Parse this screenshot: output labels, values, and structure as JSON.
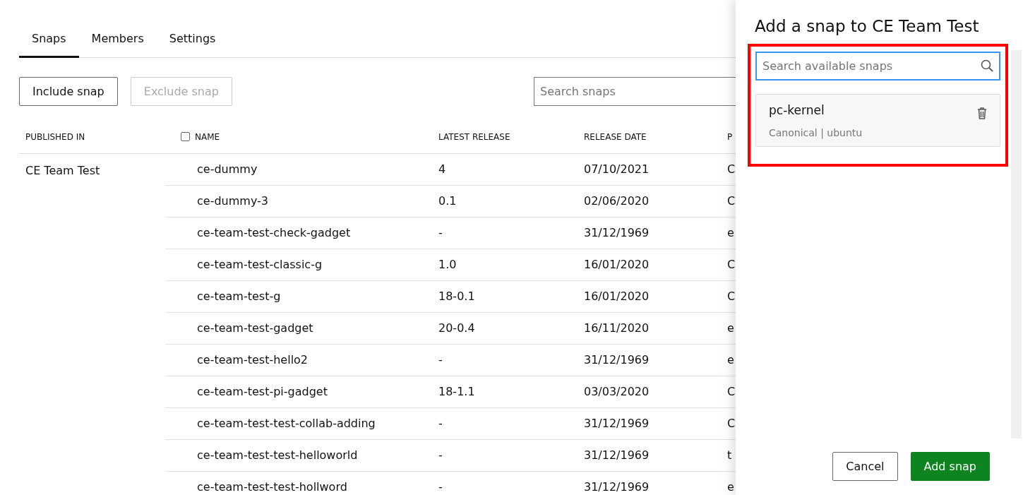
{
  "tabs": [
    {
      "label": "Snaps",
      "selected": true
    },
    {
      "label": "Members",
      "selected": false
    },
    {
      "label": "Settings",
      "selected": false
    }
  ],
  "toolbar": {
    "buttons": [
      {
        "label": "Include snap",
        "disabled": false
      },
      {
        "label": "Exclude snap",
        "disabled": true
      }
    ],
    "search": {
      "placeholder": "Search snaps"
    }
  },
  "table": {
    "columns": [
      "PUBLISHED IN",
      "NAME",
      "LATEST RELEASE",
      "RELEASE DATE",
      "P"
    ],
    "select_all_checked": false,
    "group": "CE Team Test",
    "rows": [
      {
        "name": "ce-dummy",
        "latest_release": "4",
        "release_date": "07/10/2021",
        "column_5": "C"
      },
      {
        "name": "ce-dummy-3",
        "latest_release": "0.1",
        "release_date": "02/06/2020",
        "column_5": "C"
      },
      {
        "name": "ce-team-test-check-gadget",
        "latest_release": "-",
        "release_date": "31/12/1969",
        "column_5": "e"
      },
      {
        "name": "ce-team-test-classic-g",
        "latest_release": "1.0",
        "release_date": "16/01/2020",
        "column_5": "C"
      },
      {
        "name": "ce-team-test-g",
        "latest_release": "18-0.1",
        "release_date": "16/01/2020",
        "column_5": "C"
      },
      {
        "name": "ce-team-test-gadget",
        "latest_release": "20-0.4",
        "release_date": "16/11/2020",
        "column_5": "e"
      },
      {
        "name": "ce-team-test-hello2",
        "latest_release": "-",
        "release_date": "31/12/1969",
        "column_5": "e"
      },
      {
        "name": "ce-team-test-pi-gadget",
        "latest_release": "18-1.1",
        "release_date": "03/03/2020",
        "column_5": "C"
      },
      {
        "name": "ce-team-test-test-collab-adding",
        "latest_release": "-",
        "release_date": "31/12/1969",
        "column_5": "C"
      },
      {
        "name": "ce-team-test-test-helloworld",
        "latest_release": "-",
        "release_date": "31/12/1969",
        "column_5": "t"
      },
      {
        "name": "ce-team-test-test-hollword",
        "latest_release": "-",
        "release_date": "31/12/1969",
        "column_5": "e"
      }
    ]
  },
  "panel": {
    "title": "Add a snap to CE Team Test",
    "search": {
      "placeholder": "Search available snaps"
    },
    "selected_snaps": [
      {
        "name": "pc-kernel",
        "publisher": "Canonical | ubuntu"
      }
    ],
    "buttons": [
      {
        "label": "Cancel",
        "kind": "secondary"
      },
      {
        "label": "Add snap",
        "kind": "positive"
      }
    ]
  }
}
